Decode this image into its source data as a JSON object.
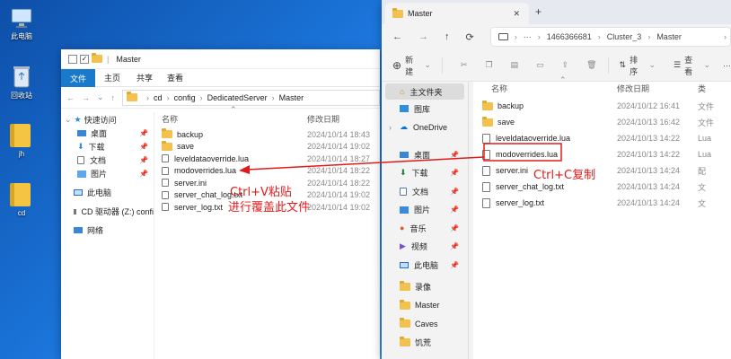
{
  "desktop": {
    "icons": [
      {
        "label": "此电脑"
      },
      {
        "label": "回收站"
      },
      {
        "label": "jh"
      },
      {
        "label": "cd"
      }
    ]
  },
  "w1": {
    "title": "Master",
    "ribbon": [
      "文件",
      "主页",
      "共享",
      "查看"
    ],
    "path": [
      "cd",
      "config",
      "DedicatedServer",
      "Master"
    ],
    "nav": [
      {
        "label": "快速访问"
      },
      {
        "label": "桌面",
        "pin": "📌"
      },
      {
        "label": "下载",
        "pin": "📌"
      },
      {
        "label": "文档",
        "pin": "📌"
      },
      {
        "label": "图片",
        "pin": "📌"
      },
      {
        "label": "此电脑"
      },
      {
        "label": "CD 驱动器 (Z:) confi"
      },
      {
        "label": "网络"
      }
    ],
    "cols": {
      "name": "名称",
      "date": "修改日期"
    },
    "files": [
      {
        "name": "backup",
        "date": "2024/10/14 18:43",
        "type": "folder"
      },
      {
        "name": "save",
        "date": "2024/10/14 19:02",
        "type": "folder"
      },
      {
        "name": "leveldataoverride.lua",
        "date": "2024/10/14 18:27",
        "type": "file"
      },
      {
        "name": "modoverrides.lua",
        "date": "2024/10/14 18:22",
        "type": "file"
      },
      {
        "name": "server.ini",
        "date": "2024/10/14 18:22",
        "type": "file"
      },
      {
        "name": "server_chat_log.txt",
        "date": "2024/10/14 19:02",
        "type": "file"
      },
      {
        "name": "server_log.txt",
        "date": "2024/10/14 19:02",
        "type": "file"
      }
    ]
  },
  "w2": {
    "tab": "Master",
    "path": [
      "1466366681",
      "Cluster_3",
      "Master"
    ],
    "toolbar": {
      "new": "新建",
      "sort": "排序",
      "view": "查看"
    },
    "nav": [
      {
        "label": "主文件夹",
        "kind": "home"
      },
      {
        "label": "图库",
        "kind": "gallery"
      },
      {
        "label": "OneDrive",
        "kind": "cloud"
      },
      {
        "label": "桌面",
        "kind": "desk",
        "pin": "📌"
      },
      {
        "label": "下载",
        "kind": "dl",
        "pin": "📌"
      },
      {
        "label": "文档",
        "kind": "docs",
        "pin": "📌"
      },
      {
        "label": "图片",
        "kind": "pics",
        "pin": "📌"
      },
      {
        "label": "音乐",
        "kind": "music",
        "pin": "📌"
      },
      {
        "label": "视频",
        "kind": "video",
        "pin": "📌"
      },
      {
        "label": "此电脑",
        "kind": "pc",
        "pin": "📌"
      },
      {
        "label": "录像",
        "kind": "folder"
      },
      {
        "label": "Master",
        "kind": "folder"
      },
      {
        "label": "Caves",
        "kind": "folder"
      },
      {
        "label": "饥荒",
        "kind": "folder"
      }
    ],
    "cols": {
      "name": "名称",
      "date": "修改日期",
      "type": "类"
    },
    "files": [
      {
        "name": "backup",
        "date": "2024/10/12 16:41",
        "type": "文件",
        "kind": "folder"
      },
      {
        "name": "save",
        "date": "2024/10/13 16:42",
        "type": "文件",
        "kind": "folder"
      },
      {
        "name": "leveldataoverride.lua",
        "date": "2024/10/13 14:22",
        "type": "Lua",
        "kind": "file"
      },
      {
        "name": "modoverrides.lua",
        "date": "2024/10/13 14:22",
        "type": "Lua",
        "kind": "file"
      },
      {
        "name": "server.ini",
        "date": "2024/10/13 14:24",
        "type": "配",
        "kind": "file"
      },
      {
        "name": "server_chat_log.txt",
        "date": "2024/10/13 14:24",
        "type": "文",
        "kind": "file"
      },
      {
        "name": "server_log.txt",
        "date": "2024/10/13 14:24",
        "type": "文",
        "kind": "file"
      }
    ]
  },
  "annotations": {
    "paste": "Ctrl+V粘贴",
    "overwrite": "进行覆盖此文件",
    "copy": "Ctrl+C复制"
  },
  "colors": {
    "accent": "#0067c0",
    "annotation": "#e01b1b",
    "folder": "#f2c14e"
  }
}
